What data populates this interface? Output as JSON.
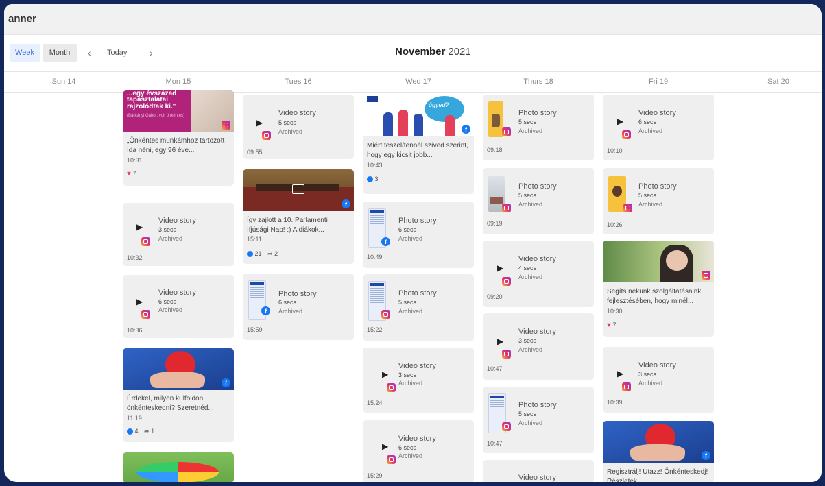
{
  "app": {
    "title": "anner"
  },
  "toolbar": {
    "week_label": "Week",
    "month_label": "Month",
    "prev_icon": "‹",
    "next_icon": "›",
    "today_label": "Today",
    "month_name": "November",
    "year": "2021"
  },
  "days": [
    "Sun 14",
    "Mon 15",
    "Tues 16",
    "Wed 17",
    "Thurs 18",
    "Fri 19",
    "Sat 20"
  ],
  "mon": {
    "c1": {
      "thumb_line1": "...egy évszázad",
      "thumb_line2": "tapasztalatai",
      "thumb_line3": "rajzolódtak ki.\"",
      "thumb_credit": "(Bárkányi Gábor, volt önkéntes)",
      "text": "„Önkéntes munkámhoz tartozott Ida néni, egy 96 éve...",
      "time": "10:31",
      "hearts": "7"
    },
    "c2": {
      "title": "Video story",
      "secs": "3 secs",
      "status": "Archived",
      "time": "10:32"
    },
    "c3": {
      "title": "Video story",
      "secs": "6 secs",
      "status": "Archived",
      "time": "10:36"
    },
    "c4": {
      "text": "Érdekel, milyen külföldön önkénteskedni? Szeretnéd...",
      "time": "11:19",
      "likes": "4",
      "shares": "1"
    }
  },
  "tue": {
    "c1": {
      "title": "Video story",
      "secs": "5 secs",
      "status": "Archived",
      "time": "09:55"
    },
    "c2": {
      "text": "Így zajlott a 10. Parlamenti Ifjúsági Nap! :) A diákok...",
      "time": "15:11",
      "likes": "21",
      "shares": "2"
    },
    "c3": {
      "title": "Photo story",
      "secs": "6 secs",
      "status": "Archived",
      "time": "15:59"
    }
  },
  "wed": {
    "c1": {
      "bubble": "ügyed?",
      "text": "Miért teszel/tennél szíved szerint, hogy egy kicsit jobb...",
      "time": "10:43",
      "likes": "3"
    },
    "c2": {
      "title": "Photo story",
      "secs": "6 secs",
      "status": "Archived",
      "time": "10:49"
    },
    "c3": {
      "title": "Photo story",
      "secs": "5 secs",
      "status": "Archived",
      "time": "15:22"
    },
    "c4": {
      "title": "Video story",
      "secs": "3 secs",
      "status": "Archived",
      "time": "15:24"
    },
    "c5": {
      "title": "Video story",
      "secs": "6 secs",
      "status": "Archived",
      "time": "15:29"
    }
  },
  "thu": {
    "c1": {
      "title": "Photo story",
      "secs": "5 secs",
      "status": "Archived",
      "time": "09:18"
    },
    "c2": {
      "title": "Photo story",
      "secs": "5 secs",
      "status": "Archived",
      "time": "09:19"
    },
    "c3": {
      "title": "Video story",
      "secs": "4 secs",
      "status": "Archived",
      "time": "09:20"
    },
    "c4": {
      "title": "Video story",
      "secs": "3 secs",
      "status": "Archived",
      "time": "10:47"
    },
    "c5": {
      "title": "Photo story",
      "secs": "5 secs",
      "status": "Archived",
      "time": "10:47"
    },
    "c6": {
      "title": "Video story"
    }
  },
  "fri": {
    "c1": {
      "title": "Video story",
      "secs": "6 secs",
      "status": "Archived",
      "time": "10:10"
    },
    "c2": {
      "title": "Photo story",
      "secs": "5 secs",
      "status": "Archived",
      "time": "10:26"
    },
    "c3": {
      "text": "Segíts nekünk szolgáltatásaink fejlesztésében, hogy minél...",
      "time": "10:30",
      "hearts": "7"
    },
    "c4": {
      "title": "Video story",
      "secs": "3 secs",
      "status": "Archived",
      "time": "10:39"
    },
    "c5": {
      "text": "Regisztrálj! Utazz! Önkénteskedj! Részletek..."
    }
  }
}
